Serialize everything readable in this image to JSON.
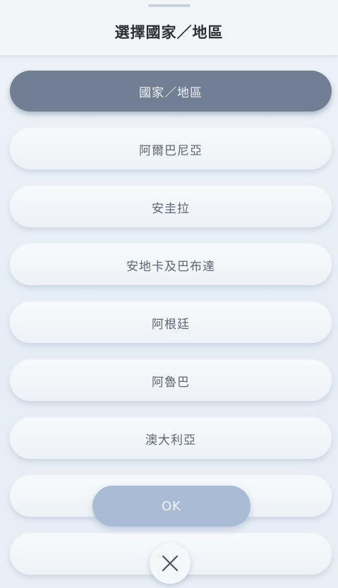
{
  "header": {
    "title": "選擇國家／地區"
  },
  "country_list": {
    "items": [
      {
        "label": "國家／地區",
        "selected": true
      },
      {
        "label": "阿爾巴尼亞",
        "selected": false
      },
      {
        "label": "安圭拉",
        "selected": false
      },
      {
        "label": "安地卡及巴布達",
        "selected": false
      },
      {
        "label": "阿根廷",
        "selected": false
      },
      {
        "label": "阿魯巴",
        "selected": false
      },
      {
        "label": "澳大利亞",
        "selected": false
      },
      {
        "label": "",
        "selected": false
      },
      {
        "label": "",
        "selected": false
      }
    ]
  },
  "actions": {
    "ok_label": "OK",
    "close_icon": "close-icon"
  },
  "colors": {
    "selected_bg": "#717e93",
    "ok_bg": "#a9bbd5",
    "text": "#5d6675",
    "title_text": "#2b2f36"
  }
}
